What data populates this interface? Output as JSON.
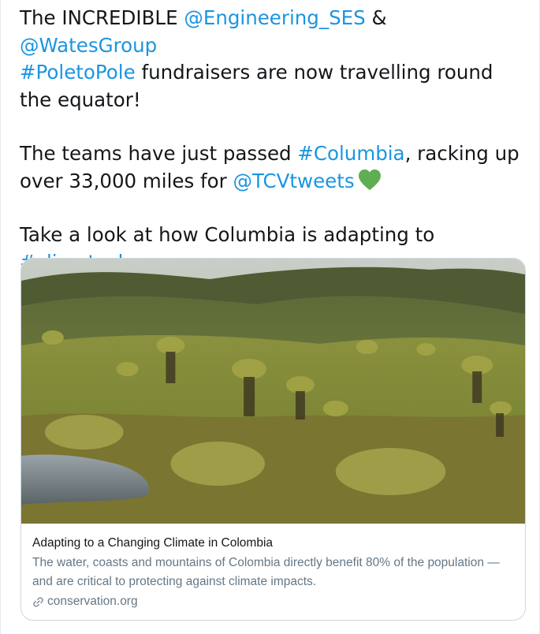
{
  "tweet": {
    "p1_a": "The INCREDIBLE ",
    "p1_mention1": "@Engineering_SES",
    "p1_b": " & ",
    "p1_mention2": "@WatesGroup",
    "p1_hashtag": "#PoletoPole",
    "p1_c": " fundraisers are now travelling round the equator!",
    "p2_a": "The teams have just passed ",
    "p2_hashtag": "#Columbia",
    "p2_b": ", racking up over 33,000 miles for ",
    "p2_mention": "@TCVtweets",
    "heart_icon": "green-heart-emoji",
    "p3_a": "Take a look at how Columbia is adapting to ",
    "p3_hashtag": "#climatechange",
    "p3_b": "..."
  },
  "card": {
    "image_alt": "Grassy highland páramo with frailejón plants and a small pond",
    "title": "Adapting to a Changing Climate in Colombia",
    "description": "The water, coasts and mountains of Colombia directly benefit 80% of the population — and are critical to protecting against climate impacts.",
    "domain": "conservation.org",
    "domain_icon": "link-icon"
  },
  "colors": {
    "link": "#1b95e0",
    "text": "#14171a",
    "muted": "#657786",
    "border": "#ccd6dd",
    "heart": "#5fae52"
  }
}
